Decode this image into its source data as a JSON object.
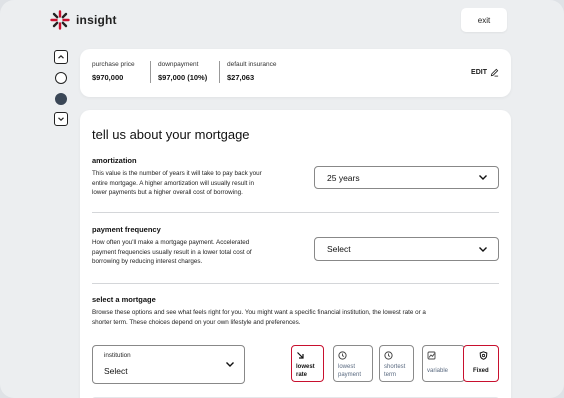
{
  "app": {
    "logo_text": "insight",
    "brand_color": "#c8102e"
  },
  "header": {
    "exit_label": "exit"
  },
  "summary": {
    "items": [
      {
        "label": "purchase price",
        "value": "$970,000"
      },
      {
        "label": "downpayment",
        "value": "$97,000 (10%)"
      },
      {
        "label": "default insurance",
        "value": "$27,063"
      }
    ],
    "edit_label": "EDIT"
  },
  "main": {
    "title": "tell us about your mortgage",
    "amortization": {
      "title": "amortization",
      "desc_lines": [
        "This value is the number of years it will take to pay back your",
        "entire mortgage. A higher amortization will usually result in",
        "lower payments but a higher overall cost of borrowing."
      ],
      "selected": "25 years"
    },
    "payment_frequency": {
      "title": "payment frequency",
      "desc_lines": [
        "How often you'll make a mortgage payment. Accelerated",
        "payment frequencies usually result in a lower total cost of",
        "borrowing by reducing interest charges."
      ],
      "selected": "Select"
    },
    "select_mortgage": {
      "title": "select a mortgage",
      "desc_lines": [
        "Browse these options and see what feels right for you. You might want a specific financial institution, the lowest rate or a",
        "shorter term. These choices depend on your own lifestyle and preferences."
      ],
      "institution_label": "institution",
      "institution_value": "Select",
      "filters": [
        {
          "line1": "lowest",
          "line2": "rate",
          "icon": "arrow-down-right-icon",
          "active": true
        },
        {
          "line1": "lowest",
          "line2": "payment",
          "icon": "clock-icon",
          "active": false
        },
        {
          "line1": "shortest",
          "line2": "term",
          "icon": "clock-icon",
          "active": false
        },
        {
          "line1": "variable",
          "line2": "",
          "icon": "chart-icon",
          "active": false
        },
        {
          "line1": "Fixed",
          "line2": "",
          "icon": "shield-icon",
          "active": true
        }
      ]
    }
  }
}
